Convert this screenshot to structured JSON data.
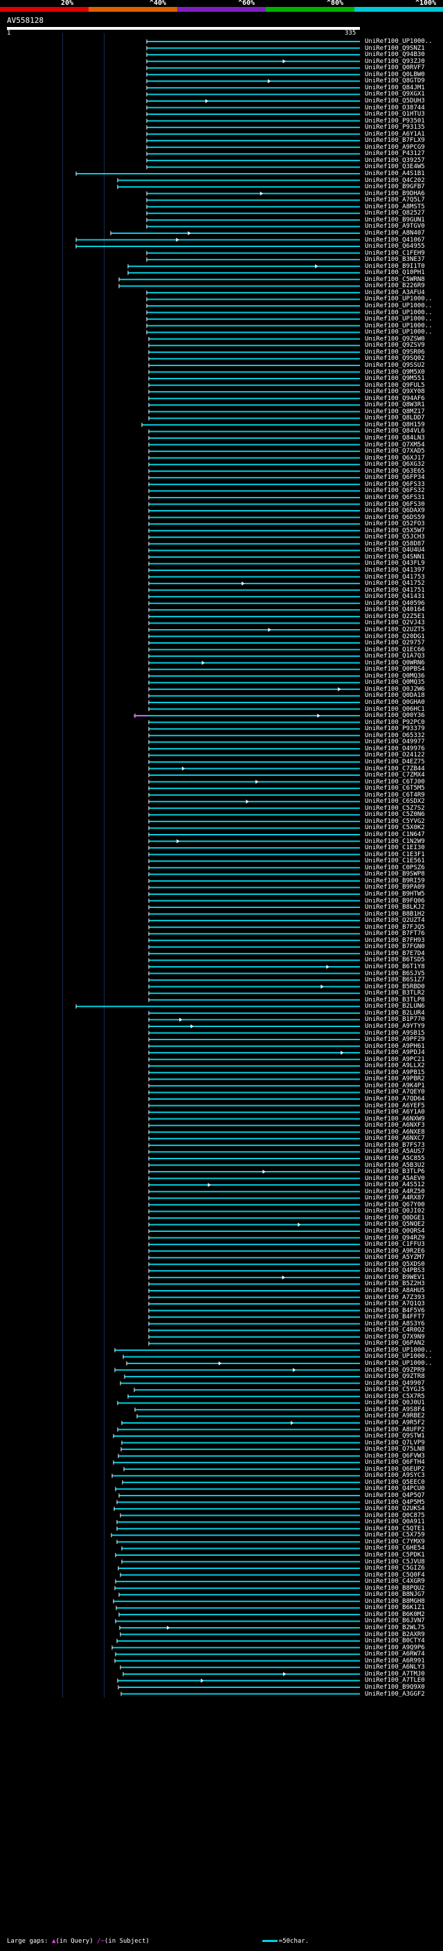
{
  "scale": {
    "labels": [
      "20%",
      "^40%",
      "^60%",
      "^80%",
      "^100%"
    ],
    "colors": [
      "#e00000",
      "#e06000",
      "#8020c0",
      "#00b000",
      "#00c8d8"
    ]
  },
  "query": {
    "id": "AV558128",
    "start": "1",
    "end": "335"
  },
  "hits": [
    "UniRef100_UP1000..",
    "UniRef100_Q9SNZ1",
    "UniRef100_Q94B30",
    "UniRef100_Q93ZJ0",
    "UniRef100_Q0RVF7",
    "UniRef100_Q0LBW0",
    "UniRef100_Q8GTD9",
    "UniRef100_Q84JM1",
    "UniRef100_Q9XGX1",
    "UniRef100_Q5DUH3",
    "UniRef100_O38744",
    "UniRef100_Q1HTU3",
    "UniRef100_P93501",
    "UniRef100_P93135",
    "UniRef100_A6Y1A1",
    "UniRef100_B7FLX9",
    "UniRef100_A9PCG9",
    "UniRef100_P43127",
    "UniRef100_Q39257",
    "UniRef100_Q3E4W5",
    "UniRef100_A4S1B1",
    "UniRef100_Q4C202",
    "UniRef100_B9GFB7",
    "UniRef100_B9DHA6",
    "UniRef100_A7Q5L7",
    "UniRef100_A8MST5",
    "UniRef100_Q82527",
    "UniRef100_B9GUN1",
    "UniRef100_A9TGV0",
    "UniRef100_A8N407",
    "UniRef100_Q41067",
    "UniRef100_Q64955",
    "UniRef100_C1FEH9",
    "UniRef100_B3NE37",
    "UniRef100_B9I1T0",
    "UniRef100_Q10PH1",
    "UniRef100_C5WRN8",
    "UniRef100_B226R9",
    "UniRef100_A3AFU4",
    "UniRef100_UP1000..",
    "UniRef100_UP1000..",
    "UniRef100_UP1000..",
    "UniRef100_UP1000..",
    "UniRef100_UP1000..",
    "UniRef100_UP1000..",
    "UniRef100_Q9ZSW0",
    "UniRef100_Q9ZSV9",
    "UniRef100_Q9SR06",
    "UniRef100_Q9SQ02",
    "UniRef100_Q9SSU2",
    "UniRef100_Q9M5X0",
    "UniRef100_Q9M551",
    "UniRef100_Q9FUL5",
    "UniRef100_Q9XY08",
    "UniRef100_Q94AF6",
    "UniRef100_Q8W3R1",
    "UniRef100_Q8MZ17",
    "UniRef100_Q8LDD7",
    "UniRef100_Q8H159",
    "UniRef100_Q84VL6",
    "UniRef100_Q84LN3",
    "UniRef100_Q7XM54",
    "UniRef100_Q7XAD5",
    "UniRef100_Q6XJ17",
    "UniRef100_Q6XG32",
    "UniRef100_Q63E65",
    "UniRef100_Q6FP34",
    "UniRef100_Q6FS33",
    "UniRef100_Q6FS32",
    "UniRef100_Q6FS31",
    "UniRef100_Q6FS30",
    "UniRef100_Q6DAX9",
    "UniRef100_Q6DS59",
    "UniRef100_Q52FO3",
    "UniRef100_Q5X5W7",
    "UniRef100_Q5JCH3",
    "UniRef100_Q58D87",
    "UniRef100_Q4U4U4",
    "UniRef100_Q4SNN1",
    "UniRef100_Q43FL9",
    "UniRef100_Q41397",
    "UniRef100_Q41753",
    "UniRef100_Q41752",
    "UniRef100_Q41751",
    "UniRef100_Q41431",
    "UniRef100_Q40596",
    "UniRef100_Q40164",
    "UniRef100_Q2Z5E1",
    "UniRef100_Q2VJ43",
    "UniRef100_Q2UZT5",
    "UniRef100_Q20DG1",
    "UniRef100_Q29757",
    "UniRef100_Q1EC66",
    "UniRef100_Q1A7Q3",
    "UniRef100_Q0WRN6",
    "UniRef100_Q0PBS4",
    "UniRef100_Q0MQ36",
    "UniRef100_Q0MQ35",
    "UniRef100_Q0J2W6",
    "UniRef100_Q0DA18",
    "UniRef100_Q0GHA0",
    "UniRef100_Q06HC1",
    "UniRef100_Q00Y36",
    "UniRef100_P92PC0",
    "UniRef100_P93379",
    "UniRef100_O65332",
    "UniRef100_O49977",
    "UniRef100_O49976",
    "UniRef100_O24122",
    "UniRef100_D4EZ75",
    "UniRef100_C7ZB44",
    "UniRef100_C7ZMX4",
    "UniRef100_C6TJ00",
    "UniRef100_C6T5M5",
    "UniRef100_C6T4R9",
    "UniRef100_C6SDX2",
    "UniRef100_C5Z7S2",
    "UniRef100_C5Z0N6",
    "UniRef100_C5YVG2",
    "UniRef100_C5X0K2",
    "UniRef100_C1N647",
    "UniRef100_C1N2W9",
    "UniRef100_C1EI30",
    "UniRef100_C1E3F1",
    "UniRef100_C1E561",
    "UniRef100_C0PSZ6",
    "UniRef100_B9SWP8",
    "UniRef100_B9RI59",
    "UniRef100_B9PA09",
    "UniRef100_B9HTW5",
    "UniRef100_B9FQ06",
    "UniRef100_B8LKJ2",
    "UniRef100_B8B1H2",
    "UniRef100_Q2UZT4",
    "UniRef100_B7FJQ5",
    "UniRef100_B7FT76",
    "UniRef100_B7FH93",
    "UniRef100_B7FGN0",
    "UniRef100_B7E7D4",
    "UniRef100_B6TSD5",
    "UniRef100_B6T1Y8",
    "UniRef100_B6SJV5",
    "UniRef100_B6S1Z7",
    "UniRef100_B5RBD0",
    "UniRef100_B3TLR2",
    "UniRef100_B3TLP8",
    "UniRef100_B2LUN6",
    "UniRef100_B2LUR4",
    "UniRef100_B1P770",
    "UniRef100_A9YTY9",
    "UniRef100_A9SB15",
    "UniRef100_A9PF29",
    "UniRef100_A9PH61",
    "UniRef100_A9PDJ4",
    "UniRef100_A9PC21",
    "UniRef100_A9LLX2",
    "UniRef100_A9PB15",
    "UniRef100_A9PBR2",
    "UniRef100_A9K4P1",
    "UniRef100_A7QEY0",
    "UniRef100_A7QD64",
    "UniRef100_A6YEF5",
    "UniRef100_A6Y1A0",
    "UniRef100_A6NXW9",
    "UniRef100_A6NXF3",
    "UniRef100_A6NXE8",
    "UniRef100_A6NXC7",
    "UniRef100_B7FS73",
    "UniRef100_A5AUS7",
    "UniRef100_A5C855",
    "UniRef100_A5B3U2",
    "UniRef100_B3TLP6",
    "UniRef100_A5AEV0",
    "UniRef100_A4S512",
    "UniRef100_A4RZ50",
    "UniRef100_A4RX87",
    "UniRef100_Q67Y00",
    "UniRef100_Q0JI02",
    "UniRef100_Q0DGE1",
    "UniRef100_Q5NQE2",
    "UniRef100_Q0QRS4",
    "UniRef100_Q94RZ9",
    "UniRef100_C1FFU3",
    "UniRef100_A9R2E6",
    "UniRef100_A5YZM7",
    "UniRef100_Q5XDS0",
    "UniRef100_Q4PBS3",
    "UniRef100_B9WEV1",
    "UniRef100_B5Z2H3",
    "UniRef100_A8AHU5",
    "UniRef100_A7Z393",
    "UniRef100_A7Q1Q3",
    "UniRef100_B4F5V6",
    "UniRef100_B4FFT7",
    "UniRef100_A8S3Y6",
    "UniRef100_C4R0Q2",
    "UniRef100_Q7X9N9",
    "UniRef100_Q6PAN2",
    "UniRef100_UP1000..",
    "UniRef100_UP1000..",
    "UniRef100_UP1000..",
    "UniRef100_Q9ZPR9",
    "UniRef100_Q9ZTR8",
    "UniRef100_Q49907",
    "UniRef100_C5YGJ5",
    "UniRef100_C5X7R5",
    "UniRef100_Q0J0U1",
    "UniRef100_A9S8F4",
    "UniRef100_A9RBE2",
    "UniRef100_A9R5F2",
    "UniRef100_A8UFP2",
    "UniRef100_Q9STW1",
    "UniRef100_Q7LVP9",
    "UniRef100_Q75LN8",
    "UniRef100_Q6FVW3",
    "UniRef100_Q6FTH4",
    "UniRef100_Q6EUP2",
    "UniRef100_A9SYC3",
    "UniRef100_Q5EEC0",
    "UniRef100_Q4PCU0",
    "UniRef100_Q4P5Q7",
    "UniRef100_Q4P5M5",
    "UniRef100_Q2UKS4",
    "UniRef100_Q0C875",
    "UniRef100_Q0A911",
    "UniRef100_C5QTE1",
    "UniRef100_C5X759",
    "UniRef100_C7YMX9",
    "UniRef100_C6HE54",
    "UniRef100_C5PDK1",
    "UniRef100_C5JVU8",
    "UniRef100_C5GIZ6",
    "UniRef100_C5Q0F4",
    "UniRef100_C4XGR9",
    "UniRef100_B8PQU2",
    "UniRef100_B8NJG7",
    "UniRef100_B8MGH8",
    "UniRef100_B6K1Z1",
    "UniRef100_B6K0M2",
    "UniRef100_B6JVN7",
    "UniRef100_B2WL75",
    "UniRef100_B2AXR9",
    "UniRef100_B0CTY4",
    "UniRef100_A9Q9P6",
    "UniRef100_A6RW74",
    "UniRef100_A6R991",
    "UniRef100_A6NLY3",
    "UniRef100_A7TMJ0",
    "UniRef100_A7TLE0",
    "UniRef100_B9Q9X0",
    "UniRef100_A3GGF2"
  ],
  "footer": {
    "gaps_label": "Large gaps:",
    "query_marker": "▲",
    "in_query": "(in Query)",
    "subject_marker": "/~",
    "in_subject": "(in Subject)",
    "legend_text": "=50char."
  },
  "colors": {
    "hit_line": "#00d0e0",
    "gap_marker": "#ff40ff",
    "background": "#000000"
  }
}
